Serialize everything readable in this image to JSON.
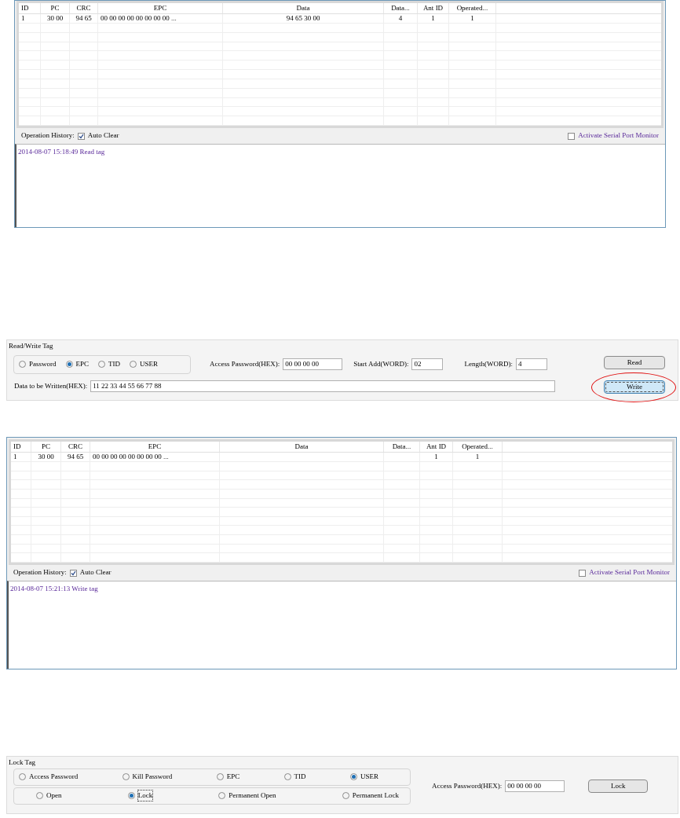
{
  "panels": [
    {
      "kind": "tag_list",
      "columns": [
        "ID",
        "PC",
        "CRC",
        "EPC",
        "Data",
        "Data...",
        "Ant ID",
        "Operated..."
      ],
      "rows": [
        [
          "1",
          "30 00",
          "94 65",
          "00 00 00 00 00 00 00 00 ...",
          "94 65 30 00",
          "4",
          "1",
          "1"
        ]
      ],
      "history_label": "Operation History:",
      "auto_clear": {
        "label": "Auto Clear",
        "checked": true
      },
      "serial_monitor": {
        "label": "Activate Serial Port Monitor",
        "checked": false
      },
      "log": [
        "2014-08-07 15:18:49 Read tag"
      ]
    },
    {
      "kind": "read_write",
      "title": "Read/Write Tag",
      "banks": [
        {
          "label": "Password",
          "selected": false
        },
        {
          "label": "EPC",
          "selected": true
        },
        {
          "label": "TID",
          "selected": false
        },
        {
          "label": "USER",
          "selected": false
        }
      ],
      "fields": [
        {
          "label": "Access Password(HEX):",
          "value": "00 00 00 00"
        },
        {
          "label": "Start Add(WORD):",
          "value": "02"
        },
        {
          "label": "Length(WORD):",
          "value": "4"
        }
      ],
      "data_label": "Data to be Written(HEX):",
      "data_value": "11 22 33 44 55 66 77 88",
      "buttons": [
        {
          "label": "Read",
          "focused": false,
          "circled": false
        },
        {
          "label": "Write",
          "focused": true,
          "circled": true
        }
      ]
    },
    {
      "kind": "tag_list",
      "columns": [
        "ID",
        "PC",
        "CRC",
        "EPC",
        "Data",
        "Data...",
        "Ant ID",
        "Operated..."
      ],
      "rows": [
        [
          "1",
          "30 00",
          "94 65",
          "00 00 00 00 00 00 00 00 ...",
          null,
          null,
          "1",
          "1"
        ]
      ],
      "history_label": "Operation History:",
      "auto_clear": {
        "label": "Auto Clear",
        "checked": true
      },
      "serial_monitor": {
        "label": "Activate Serial Port Monitor",
        "checked": false
      },
      "log": [
        "2014-08-07 15:21:13 Write tag"
      ]
    },
    {
      "kind": "lock",
      "title": "Lock Tag",
      "areas": [
        {
          "label": "Access Password",
          "selected": false
        },
        {
          "label": "Kill Password",
          "selected": false
        },
        {
          "label": "EPC",
          "selected": false
        },
        {
          "label": "TID",
          "selected": false
        },
        {
          "label": "USER",
          "selected": true
        }
      ],
      "actions": [
        {
          "label": "Open",
          "selected": false
        },
        {
          "label": "Lock",
          "selected": true
        },
        {
          "label": "Permanent Open",
          "selected": false
        },
        {
          "label": "Permanent Lock",
          "selected": false
        }
      ],
      "password_label": "Access Password(HEX):",
      "password_value": "00 00 00 00",
      "button": "Lock"
    }
  ]
}
